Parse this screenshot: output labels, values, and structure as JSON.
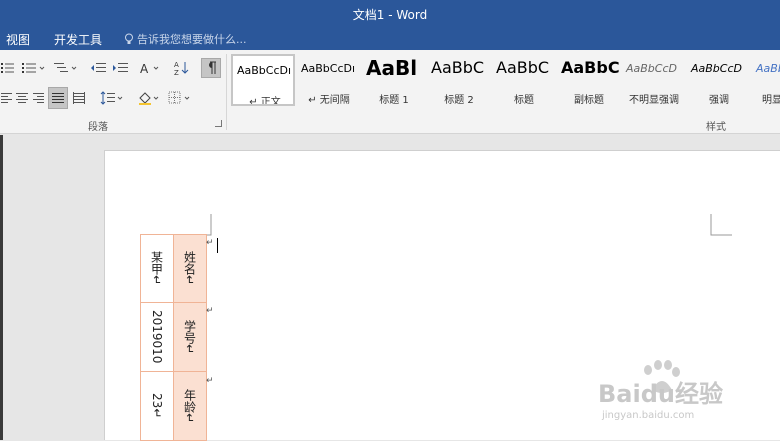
{
  "window": {
    "title": "文档1 - Word"
  },
  "menu": {
    "view": "视图",
    "developer": "开发工具",
    "tell_me": "告诉我您想要做什么..."
  },
  "ribbon": {
    "paragraph_label": "段落",
    "styles_label": "样式",
    "styles": [
      {
        "sample": "AaBbCcDı",
        "name": "↵ 正文"
      },
      {
        "sample": "AaBbCcDı",
        "name": "↵ 无间隔"
      },
      {
        "sample": "AaBl",
        "name": "标题 1"
      },
      {
        "sample": "AaBbC",
        "name": "标题 2"
      },
      {
        "sample": "AaBbC",
        "name": "标题"
      },
      {
        "sample": "AaBbC",
        "name": "副标题"
      },
      {
        "sample": "AaBbCcD",
        "name": "不明显强调"
      },
      {
        "sample": "AaBbCcD",
        "name": "强调"
      },
      {
        "sample": "AaBb",
        "name": "明显"
      }
    ]
  },
  "table": {
    "rows": [
      {
        "header": "姓名↵",
        "value": "某甲↵"
      },
      {
        "header": "学号↵",
        "value": "2019010"
      },
      {
        "header": "年龄↵",
        "value": "23↵"
      }
    ],
    "row_end_mark": "↵"
  },
  "watermark": {
    "brand": "Baidu经验",
    "url": "jingyan.baidu.com"
  },
  "colors": {
    "titlebar": "#2b579a",
    "table_border": "#f0b496",
    "table_header_fill": "#fbe0d2"
  }
}
